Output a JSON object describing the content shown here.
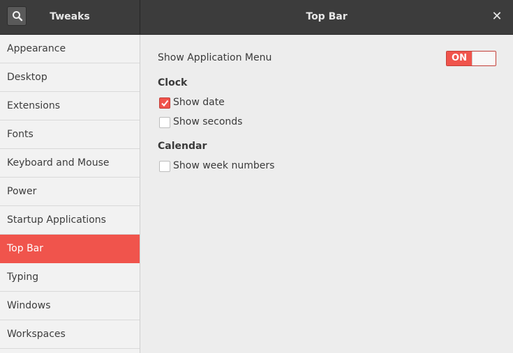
{
  "header": {
    "app_title": "Tweaks",
    "page_title": "Top Bar",
    "close_glyph": "✕",
    "search_icon": "search-icon",
    "close_icon": "close-icon"
  },
  "sidebar": {
    "items": [
      {
        "label": "Appearance"
      },
      {
        "label": "Desktop"
      },
      {
        "label": "Extensions"
      },
      {
        "label": "Fonts"
      },
      {
        "label": "Keyboard and Mouse"
      },
      {
        "label": "Power"
      },
      {
        "label": "Startup Applications"
      },
      {
        "label": "Top Bar",
        "selected": true
      },
      {
        "label": "Typing"
      },
      {
        "label": "Windows"
      },
      {
        "label": "Workspaces"
      }
    ]
  },
  "main": {
    "show_app_menu": {
      "label": "Show Application Menu",
      "state": "ON",
      "value": true
    },
    "clock": {
      "heading": "Clock",
      "show_date": {
        "label": "Show date",
        "checked": true
      },
      "show_seconds": {
        "label": "Show seconds",
        "checked": false
      }
    },
    "calendar": {
      "heading": "Calendar",
      "show_week_numbers": {
        "label": "Show week numbers",
        "checked": false
      }
    }
  },
  "colors": {
    "accent": "#f0544c",
    "titlebar": "#3c3c3c",
    "sidebar_bg": "#f2f2f2",
    "content_bg": "#ededed"
  }
}
